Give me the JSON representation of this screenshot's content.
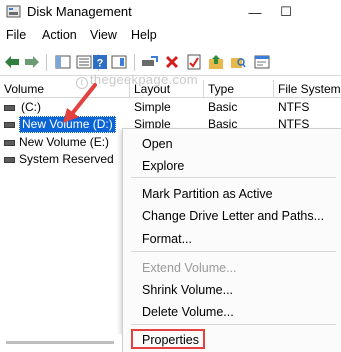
{
  "window": {
    "title": "Disk Management",
    "controls": {
      "minimize": "—",
      "maximize": "☐"
    }
  },
  "menu": [
    "File",
    "Action",
    "View",
    "Help"
  ],
  "watermark": "thegeekpage.com",
  "table": {
    "columns": [
      "Volume",
      "Layout",
      "Type",
      "File System"
    ],
    "rows": [
      {
        "volume": "(C:)",
        "layout": "Simple",
        "type": "Basic",
        "fs": "NTFS"
      },
      {
        "volume": "New Volume (D:)",
        "layout": "Simple",
        "type": "Basic",
        "fs": "NTFS"
      },
      {
        "volume": "New Volume (E:)",
        "layout": "",
        "type": "",
        "fs": ""
      },
      {
        "volume": "System Reserved",
        "layout": "",
        "type": "",
        "fs": ""
      }
    ]
  },
  "context_menu": {
    "items": [
      {
        "label": "Open",
        "enabled": true
      },
      {
        "label": "Explore",
        "enabled": true
      },
      {
        "label": "Mark Partition as Active",
        "enabled": true
      },
      {
        "label": "Change Drive Letter and Paths...",
        "enabled": true
      },
      {
        "label": "Format...",
        "enabled": true
      },
      {
        "label": "Extend Volume...",
        "enabled": false
      },
      {
        "label": "Shrink Volume...",
        "enabled": true
      },
      {
        "label": "Delete Volume...",
        "enabled": true
      },
      {
        "label": "Properties",
        "enabled": true
      }
    ]
  },
  "colors": {
    "selection": "#0a64d6",
    "annotation_red": "#e34040",
    "disabled_text": "#9a9a9a"
  }
}
